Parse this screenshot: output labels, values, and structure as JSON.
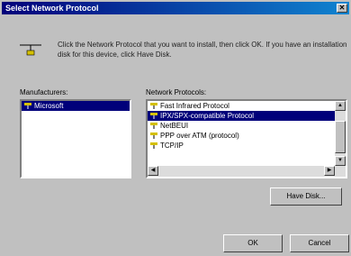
{
  "window": {
    "title": "Select Network Protocol"
  },
  "intro_text": "Click the Network Protocol that you want to install, then click OK. If you have an installation disk for this device, click Have Disk.",
  "manufacturers": {
    "label": "Manufacturers:",
    "items": [
      {
        "label": "Microsoft",
        "selected": true
      }
    ]
  },
  "protocols": {
    "label": "Network Protocols:",
    "items": [
      {
        "label": "Fast Infrared Protocol",
        "selected": false
      },
      {
        "label": "IPX/SPX-compatible Protocol",
        "selected": true
      },
      {
        "label": "NetBEUI",
        "selected": false
      },
      {
        "label": "PPP over ATM (protocol)",
        "selected": false
      },
      {
        "label": "TCP/IP",
        "selected": false
      }
    ]
  },
  "buttons": {
    "have_disk": "Have Disk...",
    "ok": "OK",
    "cancel": "Cancel"
  },
  "colors": {
    "selection": "#00007a",
    "window": "#c0c0c0"
  }
}
